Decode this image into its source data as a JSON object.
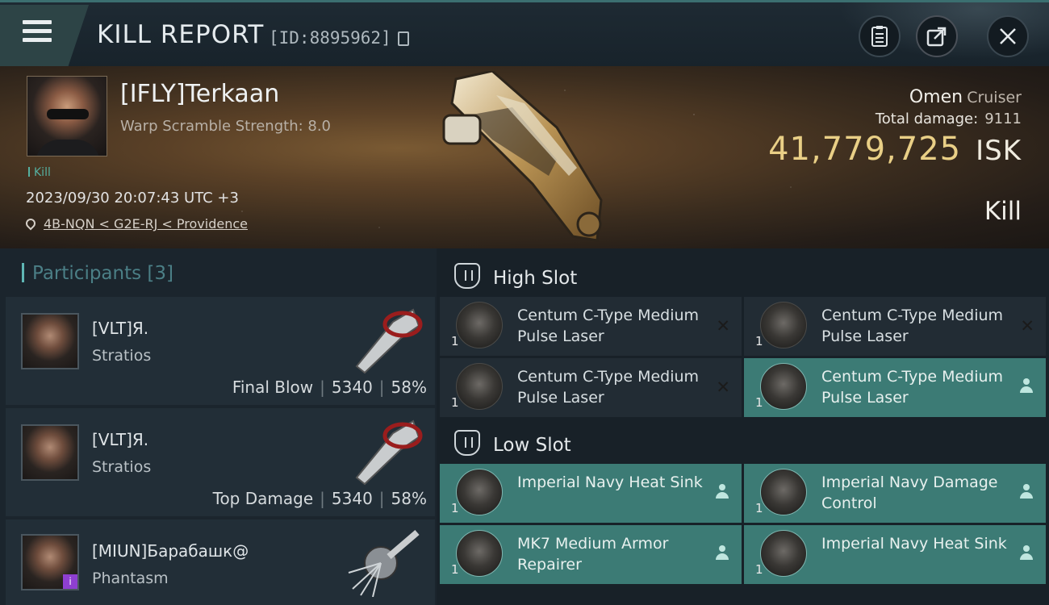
{
  "header": {
    "title": "KILL REPORT",
    "report_id": "[ID:8895962]"
  },
  "victim": {
    "name": "[IFLY]Terkaan",
    "subtitle": "Warp Scramble Strength: 8.0",
    "tag": "Kill",
    "timestamp": "2023/09/30 20:07:43 UTC +3",
    "location": "4B-NQN < G2E-RJ < Providence"
  },
  "summary": {
    "ship_name": "Omen",
    "ship_class": "Cruiser",
    "damage_label": "Total damage:",
    "damage_value": "9111",
    "isk_value": "41,779,725",
    "isk_unit": "ISK",
    "result": "Kill"
  },
  "participants": {
    "label": "Participants",
    "count": "[3]",
    "rows": [
      {
        "name": "[VLT]Я.",
        "ship": "Stratios",
        "role": "Final Blow",
        "damage": "5340",
        "percent": "58%"
      },
      {
        "name": "[VLT]Я.",
        "ship": "Stratios",
        "role": "Top Damage",
        "damage": "5340",
        "percent": "58%"
      },
      {
        "name": "[MIUN]Барабашк@",
        "ship": "Phantasm",
        "role": "",
        "damage": "",
        "percent": ""
      }
    ],
    "badge": "i"
  },
  "slots": {
    "high": {
      "label": "High Slot",
      "items": [
        {
          "name": "Centum C-Type Medium Pulse Laser",
          "qty": "1",
          "state": "destroyed"
        },
        {
          "name": "Centum C-Type Medium Pulse Laser",
          "qty": "1",
          "state": "destroyed"
        },
        {
          "name": "Centum C-Type Medium Pulse Laser",
          "qty": "1",
          "state": "destroyed"
        },
        {
          "name": "Centum C-Type Medium Pulse Laser",
          "qty": "1",
          "state": "dropped"
        }
      ]
    },
    "low": {
      "label": "Low Slot",
      "items": [
        {
          "name": "Imperial Navy Heat Sink",
          "qty": "1",
          "state": "dropped"
        },
        {
          "name": "Imperial Navy Damage Control",
          "qty": "1",
          "state": "dropped"
        },
        {
          "name": "MK7 Medium Armor Repairer",
          "qty": "1",
          "state": "dropped"
        },
        {
          "name": "Imperial Navy Heat Sink",
          "qty": "1",
          "state": "dropped"
        }
      ]
    }
  },
  "icons": {
    "menu": "menu-icon",
    "copy": "copy-icon",
    "clipboard": "clipboard-icon",
    "share": "share-icon",
    "close": "close-icon",
    "location": "location-pin-icon",
    "slot": "shield-slot-icon",
    "destroyed": "x-icon",
    "dropped": "person-icon"
  },
  "colors": {
    "accent": "#3c7b75",
    "isk": "#e9cf86",
    "participants_header": "#4b7f86"
  }
}
